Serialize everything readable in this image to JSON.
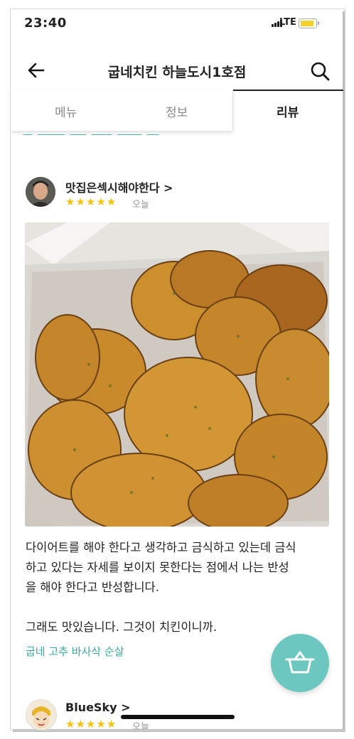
{
  "status_bar": {
    "time": "23:40",
    "network": "LTE"
  },
  "nav": {
    "title": "굽네치킨 하늘도시1호점",
    "back_icon": "arrow-left-icon",
    "search_icon": "search-icon"
  },
  "tabs": [
    {
      "label": "메뉴",
      "active": false
    },
    {
      "label": "정보",
      "active": false
    },
    {
      "label": "리뷰",
      "active": true
    }
  ],
  "reviews": [
    {
      "reviewer": "맛집은섹시해야한다 >",
      "stars": "★★★★★",
      "date": "오늘",
      "rating": 5,
      "text_lines": [
        "다이어트를 해야 한다고 생각하고 금식하고 있는데 금식",
        "하고 있다는 자세를 보이지 못한다는 점에서 나는 반성",
        "을 해야 한다고 반성합니다.",
        "",
        "그래도 맛있습니다. 그것이 치킨이니까."
      ],
      "menu_tag": "굽네 고추 바사삭 순살"
    },
    {
      "reviewer": "BlueSky >",
      "stars": "★★★★★",
      "date": "오늘",
      "rating": 5
    }
  ],
  "cart_icon": "basket-icon",
  "colors": {
    "accent": "#6cc7c0",
    "star": "#f4c20d",
    "link": "#3aa9a0"
  }
}
